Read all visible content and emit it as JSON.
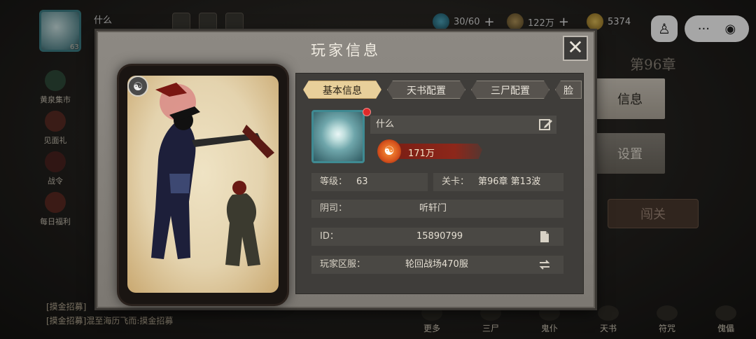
{
  "background": {
    "player_name": "什么",
    "player_level": "63",
    "resources": [
      {
        "icon": "jade-icon",
        "value": "30/60"
      },
      {
        "icon": "coin-icon",
        "value": "122万"
      },
      {
        "icon": "gold-ingot-icon",
        "value": "5374"
      }
    ],
    "side_menu": [
      "黄泉集市",
      "见面礼",
      "战令",
      "每日福利"
    ],
    "chapter": "第96章",
    "right_tabs": {
      "info": "信息",
      "settings": "设置"
    },
    "gate_button": "闯关",
    "chat_lines": [
      "[摸金招募]",
      "[摸金招募]混至海历飞而:摸金招募"
    ],
    "bottom_bar": [
      "更多",
      "三尸",
      "鬼仆",
      "天书",
      "符咒",
      "傀儡"
    ]
  },
  "modal": {
    "title": "玩家信息",
    "close_label": "✕",
    "tabs": [
      {
        "label": "基本信息",
        "active": true
      },
      {
        "label": "天书配置",
        "active": false
      },
      {
        "label": "三尸配置",
        "active": false
      },
      {
        "label": "脸",
        "active": false
      }
    ],
    "profile": {
      "name": "什么",
      "power": "171万",
      "level_label": "等级：",
      "level_value": "63",
      "stage_label": "关卡：",
      "stage_value": "第96章  第13波",
      "yinsi_label": "阴司：",
      "yinsi_value": "听轩门",
      "id_label": "ID：",
      "id_value": "15890799",
      "zone_label": "玩家区服：",
      "zone_value": "轮回战场470服"
    }
  }
}
